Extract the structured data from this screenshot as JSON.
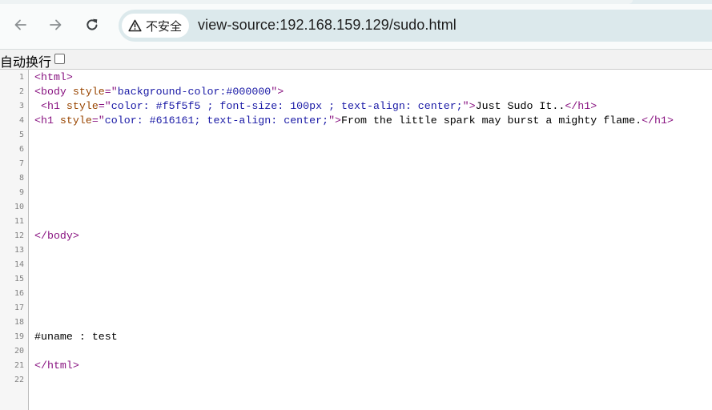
{
  "browser": {
    "security_label": "不安全",
    "url": "view-source:192.168.159.129/sudo.html"
  },
  "wrap": {
    "label": "自动换行",
    "checked": false
  },
  "colors": {
    "tag": "#881280",
    "attr": "#994500",
    "value": "#1a1aa6",
    "text": "#000000",
    "line_number": "#808080"
  },
  "source": {
    "lines": [
      {
        "n": "1",
        "tokens": [
          {
            "t": "tag",
            "v": "<html>"
          }
        ]
      },
      {
        "n": "2",
        "tokens": [
          {
            "t": "tag",
            "v": "<body "
          },
          {
            "t": "attr",
            "v": "style"
          },
          {
            "t": "tag",
            "v": "=\""
          },
          {
            "t": "val",
            "v": "background-color:#000000"
          },
          {
            "t": "tag",
            "v": "\">"
          }
        ]
      },
      {
        "n": "3",
        "tokens": [
          {
            "t": "text",
            "v": " "
          },
          {
            "t": "tag",
            "v": "<h1 "
          },
          {
            "t": "attr",
            "v": "style"
          },
          {
            "t": "tag",
            "v": "=\""
          },
          {
            "t": "val",
            "v": "color: #f5f5f5 ; font-size: 100px ; text-align: center;"
          },
          {
            "t": "tag",
            "v": "\">"
          },
          {
            "t": "text",
            "v": "Just Sudo It.."
          },
          {
            "t": "tag",
            "v": "</h1>"
          }
        ]
      },
      {
        "n": "4",
        "tokens": [
          {
            "t": "tag",
            "v": "<h1 "
          },
          {
            "t": "attr",
            "v": "style"
          },
          {
            "t": "tag",
            "v": "=\""
          },
          {
            "t": "val",
            "v": "color: #616161; text-align: center;"
          },
          {
            "t": "tag",
            "v": "\">"
          },
          {
            "t": "text",
            "v": "From the little spark may burst a mighty flame."
          },
          {
            "t": "tag",
            "v": "</h1>"
          }
        ]
      },
      {
        "n": "5",
        "tokens": []
      },
      {
        "n": "6",
        "tokens": []
      },
      {
        "n": "7",
        "tokens": []
      },
      {
        "n": "8",
        "tokens": []
      },
      {
        "n": "9",
        "tokens": []
      },
      {
        "n": "10",
        "tokens": []
      },
      {
        "n": "11",
        "tokens": []
      },
      {
        "n": "12",
        "tokens": [
          {
            "t": "tag",
            "v": "</body>"
          }
        ]
      },
      {
        "n": "13",
        "tokens": []
      },
      {
        "n": "14",
        "tokens": []
      },
      {
        "n": "15",
        "tokens": []
      },
      {
        "n": "16",
        "tokens": []
      },
      {
        "n": "17",
        "tokens": []
      },
      {
        "n": "18",
        "tokens": []
      },
      {
        "n": "19",
        "tokens": [
          {
            "t": "text",
            "v": "#uname : test"
          }
        ]
      },
      {
        "n": "20",
        "tokens": []
      },
      {
        "n": "21",
        "tokens": [
          {
            "t": "tag",
            "v": "</html>"
          }
        ]
      },
      {
        "n": "22",
        "tokens": []
      }
    ]
  }
}
